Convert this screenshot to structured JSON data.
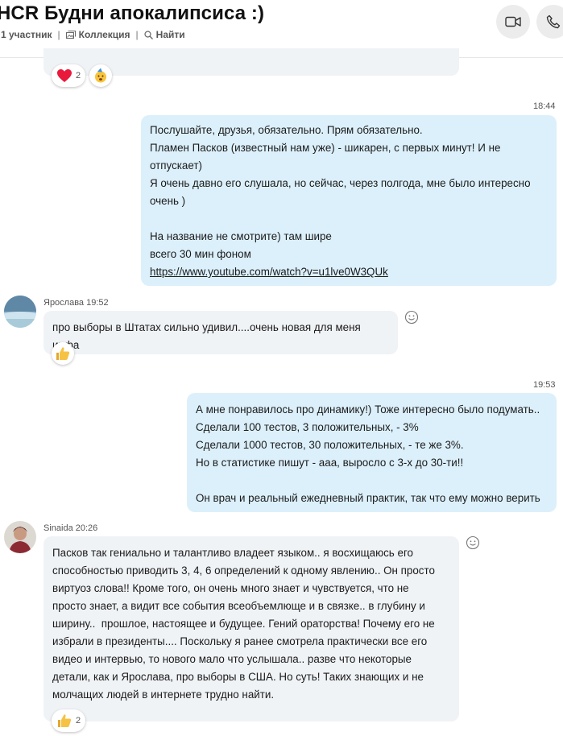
{
  "header": {
    "title": "HCR Будни апокалипсиса :)",
    "participants": "1 участник",
    "collection": "Коллекция",
    "search": "Найти"
  },
  "top_reactions": {
    "heart_count": "2"
  },
  "messages": [
    {
      "time": "18:44",
      "lines": [
        "Послушайте, друзья, обязательно. Прям обязательно.",
        "Пламен Пасков (известный нам уже) - шикарен, с первых минут! И не",
        "отпускает)",
        "Я очень давно его слушала, но сейчас, через полгода, мне было интересно",
        "очень )",
        "",
        "На название не смотрите) там шире",
        "всего 30 мин фоном"
      ],
      "link": "https://www.youtube.com/watch?v=u1lve0W3QUk"
    },
    {
      "sender": "Ярослава",
      "time": "19:52",
      "text": "про выборы в Штатах сильно удивил....очень новая для меня инфа"
    },
    {
      "time": "19:53",
      "lines": [
        "А мне понравилось про динамику!) Тоже интересно было подумать..",
        "Сделали 100 тестов, 3 положительных, - 3%",
        "Сделали 1000 тестов, 30 положительных, - те же 3%.",
        "Но в статистике пишут - ааа, выросло с 3-х до 30-ти!!",
        "",
        "Он врач и реальный ежедневный практик, так что ему можно верить"
      ]
    },
    {
      "sender": "Sinaida",
      "time": "20:26",
      "lines": [
        "Пасков так гениально и талантливо владеет языком.. я восхищаюсь его",
        "способностью приводить 3, 4, 6 определений к одному явлению.. Он просто",
        "виртуоз слова!! Кроме того, он очень много знает и чувствуется, что не",
        "просто знает, а видит все события всеобъемлюще и в связке.. в глубину и",
        "ширину..  прошлое, настоящее и будущее. Гений ораторства! Почему его не",
        "избрали в президенты.... Поскольку я ранее смотрела практически все его",
        "видео и интервью, то нового мало что услышала.. разве что некоторые",
        "детали, как и Ярослава, про выборы в США. Но суть! Таких знающих и не",
        "молчащих людей в интернете трудно найти."
      ],
      "reaction_count": "2"
    }
  ]
}
